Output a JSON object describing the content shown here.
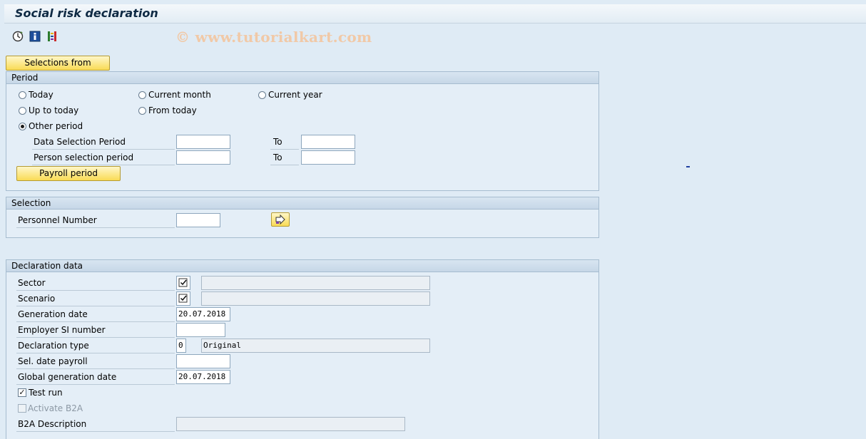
{
  "window": {
    "title": "Social risk declaration",
    "watermark": "© www.tutorialkart.com"
  },
  "toolbar": {
    "icons": [
      "execute-icon",
      "info-icon",
      "selection-options-icon"
    ]
  },
  "buttons": {
    "selections_from": "Selections from",
    "payroll_period": "Payroll period"
  },
  "period": {
    "title": "Period",
    "radios": {
      "today": "Today",
      "current_month": "Current month",
      "current_year": "Current year",
      "up_to_today": "Up to today",
      "from_today": "From today",
      "other_period": "Other period"
    },
    "selected": "other_period",
    "data_selection_label": "Data Selection Period",
    "person_selection_label": "Person selection period",
    "to_label": "To"
  },
  "selection": {
    "title": "Selection",
    "personnel_number_label": "Personnel Number",
    "personnel_number_value": ""
  },
  "declaration": {
    "title": "Declaration data",
    "sector_label": "Sector",
    "scenario_label": "Scenario",
    "generation_date_label": "Generation date",
    "generation_date_value": "20.07.2018",
    "employer_si_label": "Employer SI number",
    "employer_si_value": "",
    "declaration_type_label": "Declaration type",
    "declaration_type_value": "0",
    "declaration_type_text": "Original",
    "sel_date_payroll_label": "Sel. date payroll",
    "sel_date_payroll_value": "",
    "global_generation_date_label": "Global generation date",
    "global_generation_date_value": "20.07.2018",
    "test_run_label": "Test run",
    "test_run_checked": true,
    "activate_b2a_label": "Activate B2A",
    "activate_b2a_checked": false,
    "b2a_description_label": "B2A Description",
    "b2a_description_value": ""
  }
}
